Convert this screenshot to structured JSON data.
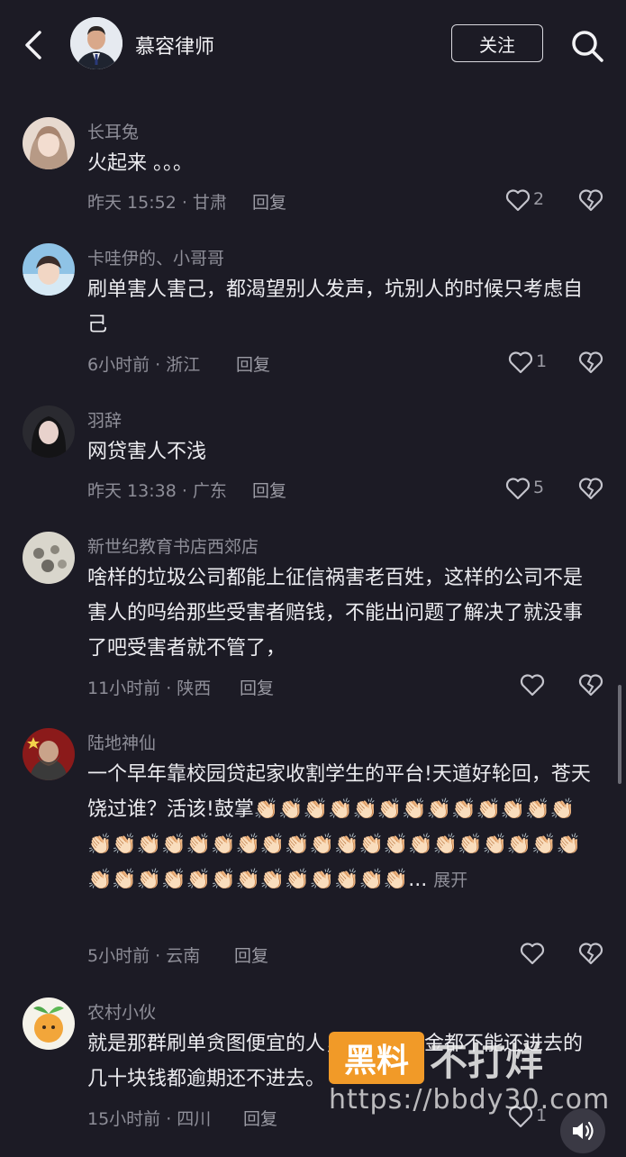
{
  "header": {
    "author_name": "慕容律师",
    "follow_label": "关注"
  },
  "comments": [
    {
      "username": "长耳兔",
      "text": "火起来 。。。",
      "meta": "昨天 15:52 · 甘肃",
      "reply_label": "回复",
      "likes": "2"
    },
    {
      "username": "卡哇伊的、小哥哥",
      "text": "刷单害人害己，都渴望别人发声，坑别人的时候只考虑自己",
      "meta": "6小时前 · 浙江",
      "reply_label": "回复",
      "likes": "1"
    },
    {
      "username": "羽辞",
      "text": "网贷害人不浅",
      "meta": "昨天 13:38 · 广东",
      "reply_label": "回复",
      "likes": "5"
    },
    {
      "username": "新世纪教育书店西郊店",
      "text": "啥样的垃圾公司都能上征信祸害老百姓，这样的公司不是害人的吗给那些受害者赔钱，不能出问题了解决了就没事了吧受害者就不管了，",
      "meta": "11小时前 · 陕西",
      "reply_label": "回复",
      "likes": ""
    },
    {
      "username": "陆地神仙",
      "text": "一个早年靠校园贷起家收割学生的平台!天道好轮回，苍天饶过谁？活该!鼓掌",
      "clap": "👏🏻",
      "ellipsis": "...",
      "expand_label": "展开",
      "meta": "5小时前 · 云南",
      "reply_label": "回复",
      "likes": ""
    },
    {
      "username": "农村小伙",
      "text": "就是那群刷单贪图便宜的人，现在连本金都不能还进去的几十块钱都逾期还不进去。",
      "meta": "15小时前 · 四川",
      "reply_label": "回复",
      "likes": "1"
    }
  ],
  "watermark": {
    "badge": "黑料",
    "text": "不打烊",
    "url": "https://bbdy30.com"
  },
  "colors": {
    "background": "#1c1b25",
    "text_primary": "#ececf0",
    "text_secondary": "#8e8e98",
    "watermark_accent": "#f19a28"
  }
}
